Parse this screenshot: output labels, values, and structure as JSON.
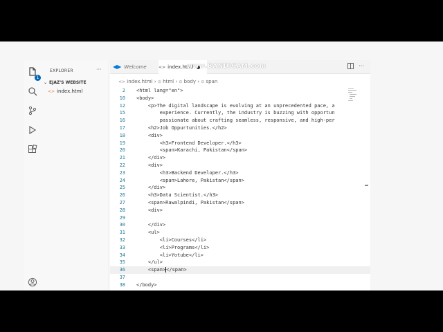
{
  "watermark": "www.BANDICAM.com",
  "sidebar": {
    "title": "EXPLORER",
    "more": "···",
    "folder": "EJAZ'S WEBSITE",
    "file": "index.html",
    "badge": "1"
  },
  "tabs": {
    "welcome": "Welcome",
    "index": "index.html"
  },
  "breadcrumb": {
    "file": "index.html",
    "html": "html",
    "body": "body",
    "span": "span"
  },
  "code": [
    {
      "num": "2",
      "text": "<html lang=\"en\">"
    },
    {
      "num": "10",
      "text": "<body>"
    },
    {
      "num": "12",
      "text": "    <p>The digital landscape is evolving at an unprecedented pace, a"
    },
    {
      "num": "15",
      "text": "        experience. Currently, the industry is buzzing with opportun"
    },
    {
      "num": "16",
      "text": "        passionate about crafting seamless, responsive, and high-per"
    },
    {
      "num": "17",
      "text": "    <h2>Job Oppurtunities.</h2>"
    },
    {
      "num": "18",
      "text": "    <div>"
    },
    {
      "num": "19",
      "text": "        <h3>Frontend Developer.</h3>"
    },
    {
      "num": "20",
      "text": "        <span>Karachi, Pakistan</span>"
    },
    {
      "num": "21",
      "text": "    </div>"
    },
    {
      "num": "22",
      "text": "    <div>"
    },
    {
      "num": "23",
      "text": "        <h3>Backend Developer.</h3>"
    },
    {
      "num": "24",
      "text": "        <span>Lahore, Pakistan</span>"
    },
    {
      "num": "25",
      "text": "    </div>"
    },
    {
      "num": "26",
      "text": "    <h3>Data Scientist.</h3>"
    },
    {
      "num": "27",
      "text": "    <span>Rawalpindi, Pakistan</span>"
    },
    {
      "num": "28",
      "text": "    <div>"
    },
    {
      "num": "29",
      "text": ""
    },
    {
      "num": "30",
      "text": "    </div>"
    },
    {
      "num": "31",
      "text": "    <ul>"
    },
    {
      "num": "32",
      "text": "        <li>Courses</li>"
    },
    {
      "num": "33",
      "text": "        <li>Programs</li>"
    },
    {
      "num": "34",
      "text": "        <li>Yotube</li>"
    },
    {
      "num": "35",
      "text": "    </ul>"
    },
    {
      "num": "36",
      "text": "    <span></span>"
    },
    {
      "num": "37",
      "text": ""
    },
    {
      "num": "38",
      "text": "</body>"
    }
  ],
  "active_line": "36",
  "icons": {
    "explorer": "files-icon",
    "search": "search-icon",
    "source_control": "source-control-icon",
    "run": "run-debug-icon",
    "extensions": "extensions-icon",
    "account": "account-icon"
  },
  "colors": {
    "line_numbers": "#237893",
    "vscode_blue": "#0078d4",
    "badge": "#0066b8"
  }
}
